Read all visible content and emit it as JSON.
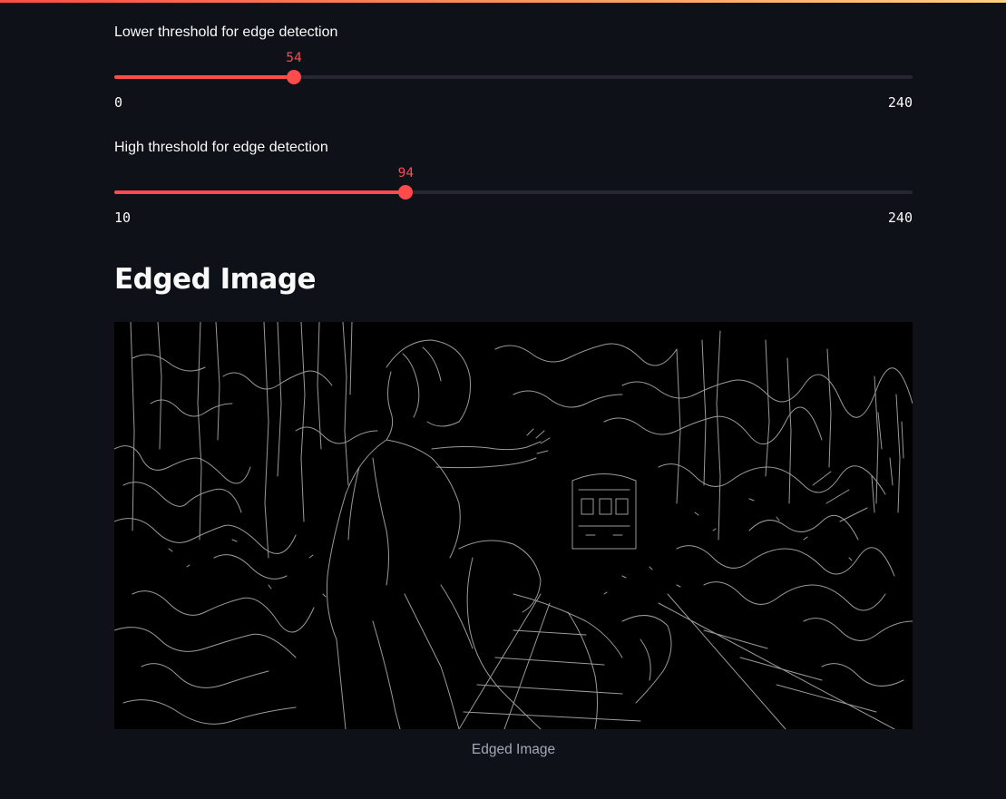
{
  "sliders": [
    {
      "label": "Lower threshold for edge detection",
      "value": 54,
      "min": 0,
      "max": 240,
      "value_text": "54",
      "min_text": "0",
      "max_text": "240"
    },
    {
      "label": "High threshold for edge detection",
      "value": 94,
      "min": 10,
      "max": 240,
      "value_text": "94",
      "min_text": "10",
      "max_text": "240"
    }
  ],
  "heading": "Edged Image",
  "image": {
    "caption": "Edged Image",
    "alt": "Edged Image"
  },
  "colors": {
    "accent": "#ff4b4b",
    "background": "#0e1117",
    "track": "#262730",
    "edge_line": "#9a9a9a"
  }
}
